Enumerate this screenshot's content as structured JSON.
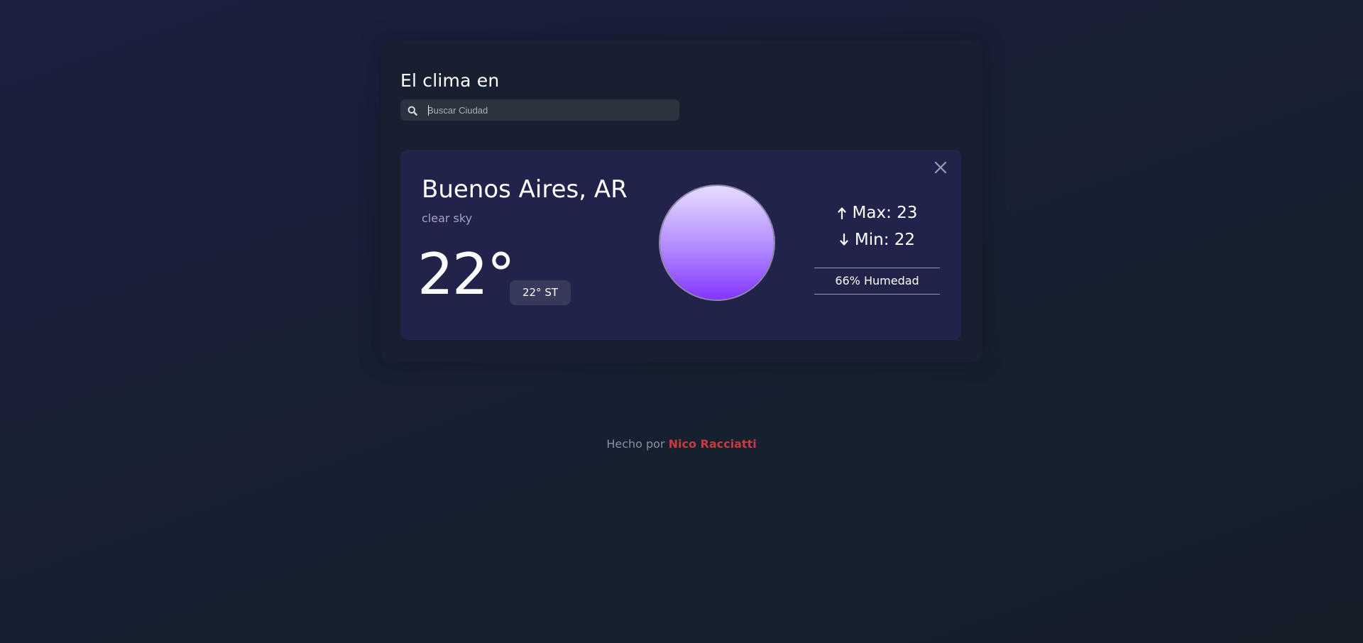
{
  "header": {
    "title": "El clima en"
  },
  "search": {
    "placeholder": "Buscar Ciudad",
    "value": "",
    "icon": "search-icon"
  },
  "weather": {
    "city": "Buenos Aires, AR",
    "description": "clear sky",
    "temperature": "22°",
    "feels_like": "22° ST",
    "max_label": "Max: 23",
    "min_label": "Min: 22",
    "humidity": "66% Humedad",
    "icon": "clear-sky-sun-icon",
    "close_icon": "close-icon"
  },
  "footer": {
    "prefix": "Hecho por ",
    "author": "Nico Racciatti"
  },
  "colors": {
    "background": "#171f2b",
    "panel": "#181f31",
    "card": "#22234a",
    "feels_badge": "#383a5b",
    "sun_top": "#e6dcff",
    "sun_bottom": "#8535ff",
    "author": "#c83a3e"
  }
}
